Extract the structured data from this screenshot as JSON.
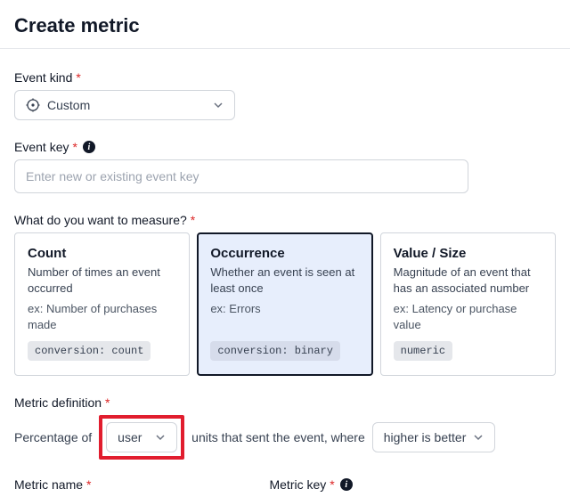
{
  "page_title": "Create metric",
  "event_kind": {
    "label": "Event kind",
    "value": "Custom"
  },
  "event_key": {
    "label": "Event key",
    "placeholder": "Enter new or existing event key"
  },
  "measure": {
    "label": "What do you want to measure?",
    "options": [
      {
        "title": "Count",
        "desc": "Number of times an event occurred",
        "example": "ex: Number of purchases made",
        "tag": "conversion: count",
        "selected": false
      },
      {
        "title": "Occurrence",
        "desc": "Whether an event is seen at least once",
        "example": "ex: Errors",
        "tag": "conversion: binary",
        "selected": true
      },
      {
        "title": "Value / Size",
        "desc": "Magnitude of an event that has an associated number",
        "example": "ex: Latency or purchase value",
        "tag": "numeric",
        "selected": false
      }
    ]
  },
  "definition": {
    "label": "Metric definition",
    "prefix": "Percentage of",
    "unit": "user",
    "middle": "units that sent the event, where",
    "direction": "higher is better"
  },
  "metric_name": {
    "label": "Metric name"
  },
  "metric_key": {
    "label": "Metric key"
  }
}
